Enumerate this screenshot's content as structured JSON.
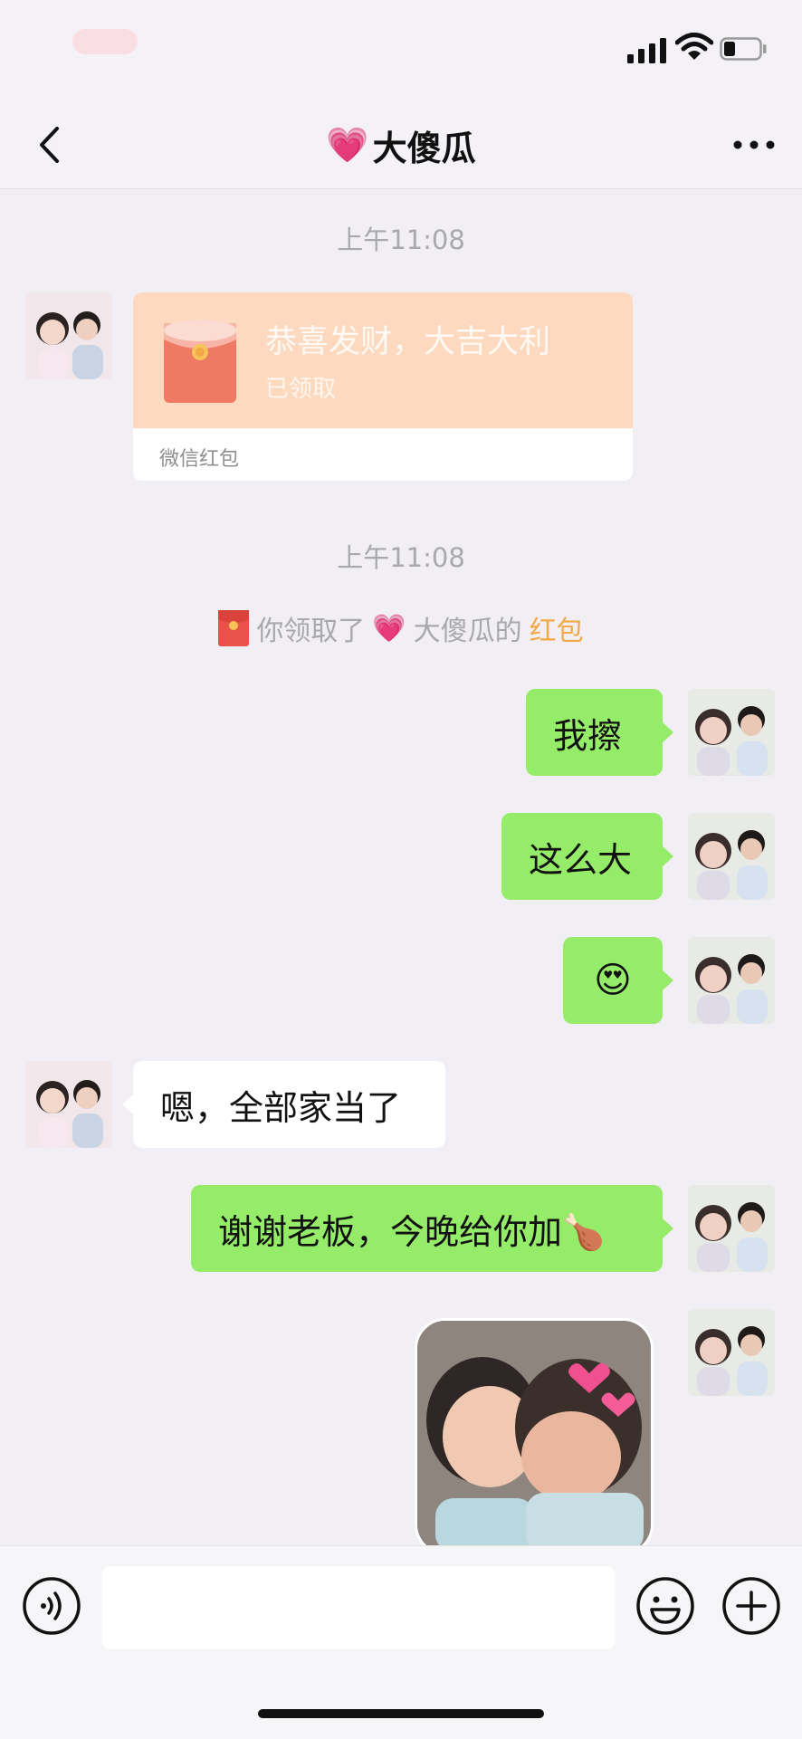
{
  "nav": {
    "title_emoji": "💗",
    "title": "大傻瓜"
  },
  "messages": {
    "time1": "上午11:08",
    "red_packet": {
      "title": "恭喜发财，大吉大利",
      "status": "已领取",
      "label": "微信红包"
    },
    "time2": "上午11:08",
    "system_notice": {
      "prefix": "你领取了",
      "emoji": "💗",
      "name": "大傻瓜的",
      "highlight": "红包"
    },
    "sent1": "我擦",
    "sent2": "这么大",
    "sent3": "😍",
    "received1": "嗯，全部家当了",
    "sent4": "谢谢老板，今晚给你加🍗"
  },
  "colors": {
    "my_bubble": "#95ec69",
    "their_bubble": "#ffffff",
    "red_packet": "#fdd9bf",
    "highlight": "#f3a848"
  },
  "icons": [
    "back-icon",
    "more-icon",
    "red-packet-icon",
    "voice-icon",
    "emoji-icon",
    "plus-icon",
    "signal-icon",
    "wifi-icon",
    "battery-icon"
  ]
}
